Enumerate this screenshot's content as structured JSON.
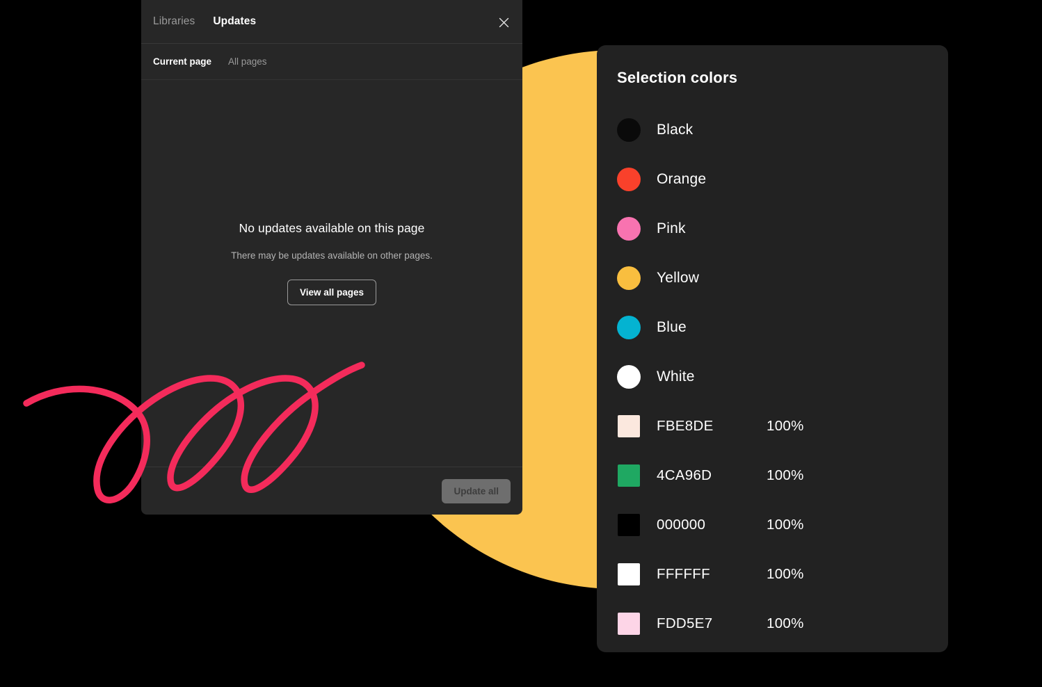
{
  "canvas": {
    "background": "#000000",
    "decoration": {
      "yellow_circle_color": "#FBC450",
      "scribble_color": "#F42B5B"
    }
  },
  "updates_panel": {
    "background": "#272727",
    "tabs": [
      {
        "label": "Libraries",
        "active": false
      },
      {
        "label": "Updates",
        "active": true
      }
    ],
    "close_icon": "close-icon",
    "subtabs": [
      {
        "label": "Current page",
        "active": true
      },
      {
        "label": "All pages",
        "active": false
      }
    ],
    "empty_state": {
      "title": "No updates available on this page",
      "subtitle": "There may be updates available on other pages.",
      "button_label": "View all pages"
    },
    "footer": {
      "update_all_label": "Update all",
      "update_all_disabled": true
    }
  },
  "selection_colors_panel": {
    "background": "#222222",
    "title": "Selection colors",
    "named_colors": [
      {
        "name": "Black",
        "swatch": "#0A0A0A"
      },
      {
        "name": "Orange",
        "swatch": "#F9412B"
      },
      {
        "name": "Pink",
        "swatch": "#F873B0"
      },
      {
        "name": "Yellow",
        "swatch": "#F9BE3F"
      },
      {
        "name": "Blue",
        "swatch": "#04B3D1"
      },
      {
        "name": "White",
        "swatch": "#FFFFFF"
      }
    ],
    "hex_colors": [
      {
        "hex": "FBE8DE",
        "swatch": "#FBE8DE",
        "opacity": "100%"
      },
      {
        "hex": "4CA96D",
        "swatch": "#1FA862",
        "opacity": "100%"
      },
      {
        "hex": "000000",
        "swatch": "#000000",
        "opacity": "100%"
      },
      {
        "hex": "FFFFFF",
        "swatch": "#FFFFFF",
        "opacity": "100%"
      },
      {
        "hex": "FDD5E7",
        "swatch": "#FDD5E7",
        "opacity": "100%"
      }
    ]
  }
}
